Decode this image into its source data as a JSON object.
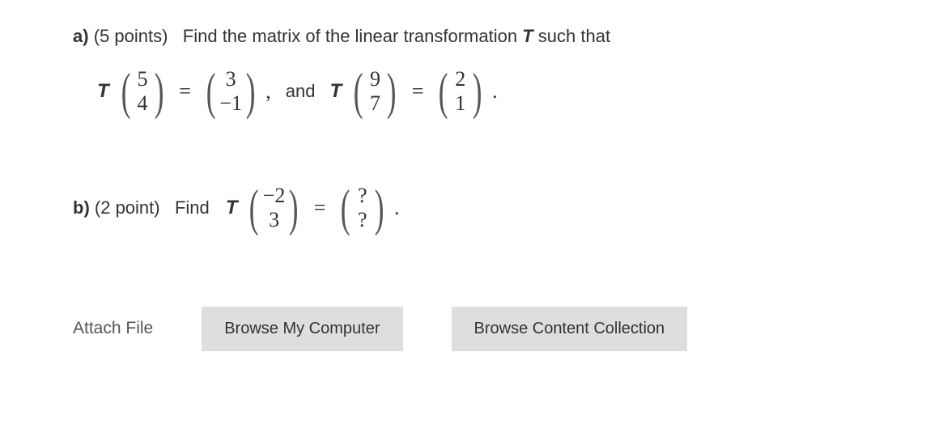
{
  "partA": {
    "label": "a)",
    "points": "(5 points)",
    "prompt_before_T": "Find the matrix of the linear transformation ",
    "T": "T",
    "prompt_after_T": " such that",
    "eq1": {
      "T": "T",
      "in": [
        "5",
        "4"
      ],
      "eq": "=",
      "out": [
        "3",
        "−1"
      ]
    },
    "joiner_comma": ",",
    "joiner_and": "and",
    "eq2": {
      "T": "T",
      "in": [
        "9",
        "7"
      ],
      "eq": "=",
      "out": [
        "2",
        "1"
      ]
    },
    "period": "."
  },
  "partB": {
    "label": "b)",
    "points": "(2 point)",
    "prompt": "Find",
    "T": "T",
    "eqn": {
      "in": [
        "−2",
        "3"
      ],
      "eq": "=",
      "out": [
        "?",
        "?"
      ]
    },
    "period": "."
  },
  "attach": {
    "label": "Attach File",
    "browse_computer": "Browse My Computer",
    "browse_collection": "Browse Content Collection"
  }
}
